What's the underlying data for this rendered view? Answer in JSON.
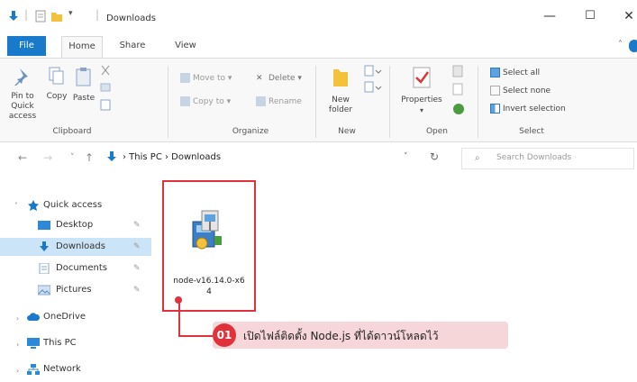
{
  "window": {
    "title": "Downloads",
    "minimize": "—",
    "maximize": "☐",
    "close": "✕"
  },
  "ribbon_tabs": [
    "File",
    "Home",
    "Share",
    "View"
  ],
  "ribbon": {
    "clipboard": {
      "pin": "Pin to Quick access",
      "copy": "Copy",
      "paste": "Paste",
      "label": "Clipboard"
    },
    "organize": {
      "move_to": "Move to ▾",
      "copy_to": "Copy to ▾",
      "delete": "Delete ▾",
      "rename": "Rename",
      "label": "Organize"
    },
    "new": {
      "new_folder": "New folder",
      "label": "New"
    },
    "open": {
      "properties": "Properties",
      "label": "Open"
    },
    "select": {
      "select_all": "Select all",
      "select_none": "Select none",
      "invert": "Invert selection",
      "label": "Select"
    }
  },
  "address": {
    "path": "›  This PC  ›  Downloads",
    "search_placeholder": "Search Downloads"
  },
  "nav": {
    "quick_access": "Quick access",
    "desktop": "Desktop",
    "downloads": "Downloads",
    "documents": "Documents",
    "pictures": "Pictures",
    "onedrive": "OneDrive",
    "this_pc": "This PC",
    "network": "Network"
  },
  "file": {
    "name_line1": "node-v16.14.0-x6",
    "name_line2": "4"
  },
  "annotation": {
    "number": "01",
    "text": "เปิดไฟล์ติดตั้ง Node.js ที่ได้ดาวน์โหลดไว้"
  },
  "colors": {
    "accent": "#1979ca",
    "highlight": "#e0323b",
    "callout_bg": "#f7d6da",
    "selection": "#cce4f7"
  }
}
